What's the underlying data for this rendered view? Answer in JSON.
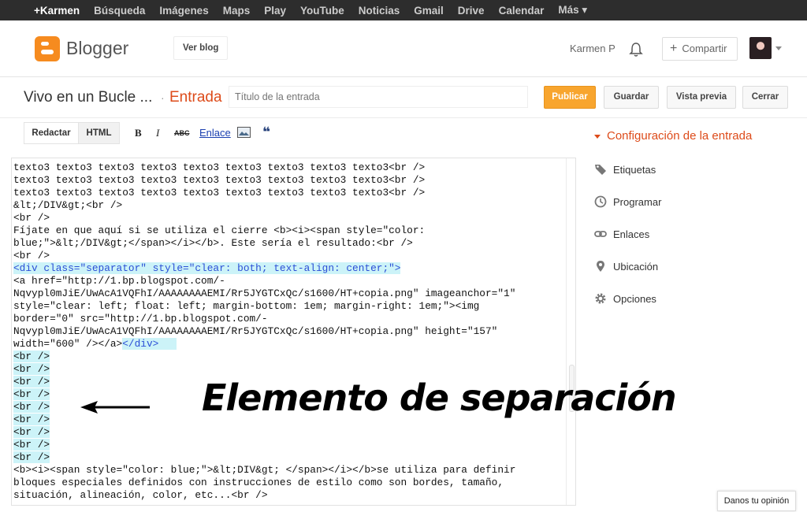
{
  "google_bar": {
    "items": [
      "+Karmen",
      "Búsqueda",
      "Imágenes",
      "Maps",
      "Play",
      "YouTube",
      "Noticias",
      "Gmail",
      "Drive",
      "Calendar",
      "Más ▾"
    ]
  },
  "header": {
    "app_name": "Blogger",
    "view_blog_label": "Ver blog",
    "user_name": "Karmen P",
    "share_label": "Compartir",
    "accent_color": "#f68b1f"
  },
  "post_bar": {
    "blog_title": "Vivo en un Bucle ...",
    "separator": "·",
    "section": "Entrada",
    "title_placeholder": "Título de la entrada",
    "publish_label": "Publicar",
    "save_label": "Guardar",
    "preview_label": "Vista previa",
    "close_label": "Cerrar"
  },
  "toolbar": {
    "compose_tab": "Redactar",
    "html_tab": "HTML",
    "bold": "B",
    "italic": "I",
    "strike": "ABC",
    "link": "Enlace",
    "quote": "❝"
  },
  "editor": {
    "lines": [
      "texto3 texto3 texto3 texto3 texto3 texto3 texto3 texto3 texto3<br />",
      "texto3 texto3 texto3 texto3 texto3 texto3 texto3 texto3 texto3<br />",
      "texto3 texto3 texto3 texto3 texto3 texto3 texto3 texto3 texto3<br />",
      "&lt;/DIV&gt;<br />",
      "<br />",
      "Fíjate en que aquí si se utiliza el cierre <b><i><span style=\"color:",
      "blue;\">&lt;/DIV&gt;</span></i></b>. Este sería el resultado:<br />",
      "<br />",
      "<div class=\"separator\" style=\"clear: both; text-align: center;\">",
      "<a href=\"http://1.bp.blogspot.com/-",
      "Nqvypl0mJiE/UwAcA1VQFhI/AAAAAAAAEMI/Rr5JYGTCxQc/s1600/HT+copia.png\" imageanchor=\"1\"",
      "style=\"clear: left; float: left; margin-bottom: 1em; margin-right: 1em;\"><img",
      "border=\"0\" src=\"http://1.bp.blogspot.com/-",
      "Nqvypl0mJiE/UwAcA1VQFhI/AAAAAAAAEMI/Rr5JYGTCxQc/s1600/HT+copia.png\" height=\"157\"",
      "width=\"600\" /></a>",
      "<br />",
      "<br />",
      "<br />",
      "<br />",
      "<br />",
      "<br />",
      "<br />",
      "<br />",
      "<br />",
      "<b><i><span style=\"color: blue;\">&lt;DIV&gt; </span></i></b>se utiliza para definir",
      "bloques especiales definidos con instrucciones de estilo como son bordes, tamaño,",
      "situación, alineación, color, etc...<br />"
    ],
    "closing_div": "</div>"
  },
  "annotation": {
    "text": "Elemento de separación"
  },
  "sidebar": {
    "heading": "Configuración de la entrada",
    "items": [
      {
        "label": "Etiquetas",
        "icon": "tag-icon"
      },
      {
        "label": "Programar",
        "icon": "clock-icon"
      },
      {
        "label": "Enlaces",
        "icon": "link-icon"
      },
      {
        "label": "Ubicación",
        "icon": "pin-icon"
      },
      {
        "label": "Opciones",
        "icon": "gear-icon"
      }
    ]
  },
  "feedback_label": "Danos tu opinión"
}
